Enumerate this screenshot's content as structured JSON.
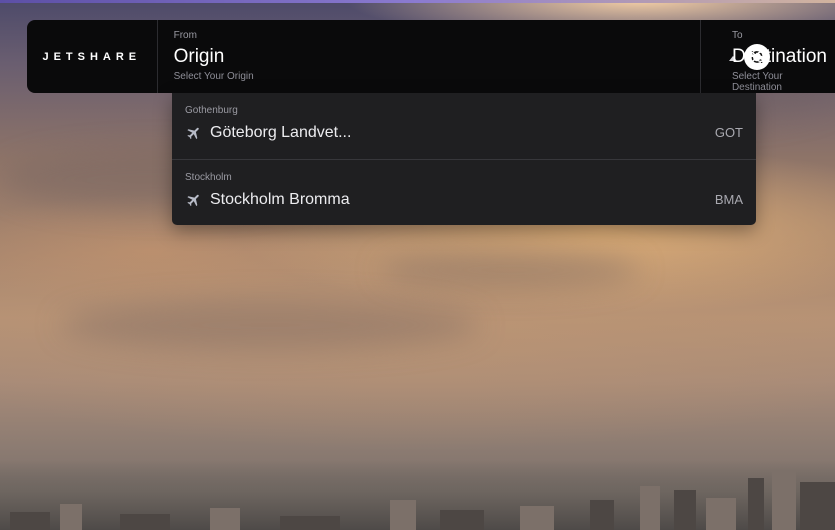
{
  "brand": {
    "logo_text": "JETSHARE"
  },
  "search": {
    "from": {
      "label": "From",
      "value": "Origin",
      "hint": "Select Your Origin"
    },
    "to": {
      "label": "To",
      "value": "Destination",
      "hint": "Select Your Destination"
    },
    "swap_icon": "swap-icon"
  },
  "dropdown": {
    "options": [
      {
        "city": "Gothenburg",
        "airport": "Göteborg Landvet...",
        "code": "GOT",
        "icon": "plane-icon"
      },
      {
        "city": "Stockholm",
        "airport": "Stockholm Bromma",
        "code": "BMA",
        "icon": "plane-icon"
      }
    ]
  }
}
